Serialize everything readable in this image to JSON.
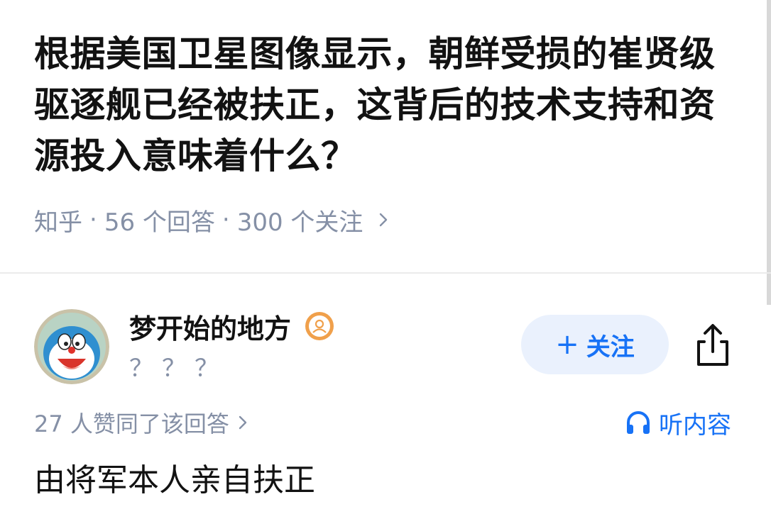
{
  "question": {
    "title": "根据美国卫星图像显示，朝鲜受损的崔贤级驱逐舰已经被扶正，这背后的技术支持和资源投入意味着什么？",
    "source": "知乎",
    "separator": "·",
    "answer_count": "56 个回答",
    "follower_count": "300 个关注",
    "chevron_icon": "chevron-right-icon"
  },
  "answer": {
    "author": {
      "avatar_icon": "cartoon-avatar",
      "name": "梦开始的地方",
      "badge_icon": "person-badge-icon",
      "bio": "？？？"
    },
    "follow_button": {
      "plus": "+",
      "label": "关注"
    },
    "share_icon": "share-icon",
    "upvote_text": "27 人赞同了该回答",
    "listen": {
      "icon": "headphones-icon",
      "label": "听内容"
    },
    "content": "由将军本人亲自扶正"
  },
  "colors": {
    "accent": "#1772f6",
    "meta_text": "#8590a6",
    "badge": "#f0a04b"
  }
}
